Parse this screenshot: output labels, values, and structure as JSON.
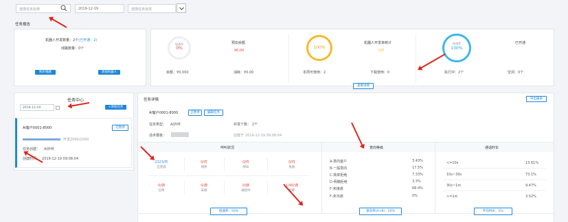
{
  "filters": {
    "search_placeholder": "选择任务名称",
    "date_value": "2019-12-19",
    "status_placeholder": "选择任务状态"
  },
  "section": {
    "task_report": "任务报告"
  },
  "summary": {
    "robot_label": "机器人开发数量：",
    "robot_value": "2个",
    "robot_extra": "(已开通：2)",
    "lines_label": "线路数量：",
    "lines_value": "0个",
    "btn_buy": "购买线路",
    "btn_add_robot": "添加机器人",
    "c1_label": "接通率",
    "c1_value": "0%",
    "c1_title": "预扣余额",
    "c1_amount": "¥0.00",
    "c1_left_label": "余额：",
    "c1_left_value": "¥0.000",
    "c1_right_label": "消耗：",
    "c1_right_value": "¥0.00",
    "c2_value": "100%",
    "c2_title": "机器人开发率统计",
    "c2_sub": "0/0",
    "c2_left_label": "本周可使用：",
    "c2_left_value": "2",
    "c2_right_label": "下载使用：",
    "c2_right_value": "0",
    "c3_label": "接通率",
    "c3_value": "100%",
    "c3_title": "已开通",
    "c3_left_label": "执行中：",
    "c3_left_value": "2个",
    "c3_right_label": "空闲：",
    "c3_right_value": "0个",
    "view_detail": "查看详情"
  },
  "task_center": {
    "title": "任务中心",
    "date": "2019-12-19",
    "add_btn": "+添加任务",
    "card_name": "AI客户0001-8000",
    "card_btn": "已暂停",
    "progress_text": "开发2000/2000",
    "creator_label": "任务创建：",
    "creator_value": "AI外呼",
    "created_label": "创建时间：",
    "created_value": "2019-12-19 09:08:04"
  },
  "detail": {
    "title": "任务详情",
    "export_btn": "导出报表",
    "task_name": "AI客户0001-8000",
    "btn_pause": "已暂停",
    "btn_edit": "编辑任务",
    "type_label": "任务类型：",
    "type_value": "AI外呼",
    "concurrency_label": "并发个数：",
    "concurrency_value": "2个",
    "robot_label": "话术模板：",
    "create_label": "创建于",
    "create_value": "2019-12-19 09:08:04"
  },
  "call_status": {
    "title": "呼叫状况",
    "row1": [
      {
        "value": "2323/件",
        "label": "已完成"
      },
      {
        "value": "0/件",
        "label": "待呼"
      },
      {
        "value": "0/件",
        "label": "呼叫"
      },
      {
        "value": "0/件",
        "label": "失败"
      }
    ],
    "row2": [
      {
        "value": "0/通",
        "label": "已呼"
      },
      {
        "value": "0/通",
        "label": "未接"
      },
      {
        "value": "0/通",
        "label": "通话中"
      },
      {
        "value": "1/40/通",
        "label": "挂断"
      }
    ],
    "footer_btn": "接通率：50%"
  },
  "intent": {
    "title": "意向等级",
    "rows": [
      {
        "label": "A-意向客户",
        "value": "3.43%"
      },
      {
        "label": "B-一般意向",
        "value": "17.5%"
      },
      {
        "label": "C-简单拒绝",
        "value": "7.33%"
      },
      {
        "label": "D-明确拒绝",
        "value": "3.3%"
      },
      {
        "label": "F-未接通",
        "value": "68.4%"
      },
      {
        "label": "F-未沟通",
        "value": "0%"
      }
    ],
    "footer_btn": "意向率(A+B)：20%"
  },
  "duration": {
    "title": "通话时长",
    "rows": [
      {
        "label": "<=10s",
        "value": "13.61%"
      },
      {
        "label": "10s~30s",
        "value": "73.1%"
      },
      {
        "label": "30s~1m",
        "value": "9.47%"
      },
      {
        "label": ">=1m",
        "value": "3.52%"
      }
    ],
    "footer_btn": "平均时长：21s"
  },
  "colors": {
    "accent": "#1f86d8",
    "ring_red": "#e8453c",
    "ring_yellow": "#f6b92c",
    "ring_cyan": "#3cb8e4",
    "arrow": "#e0241b"
  }
}
